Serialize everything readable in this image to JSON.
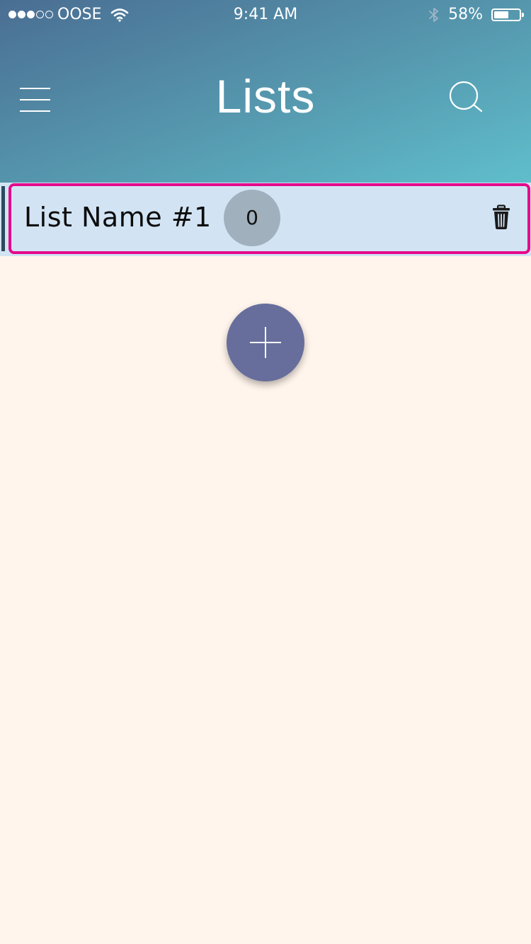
{
  "status_bar": {
    "carrier": "OOSE",
    "time": "9:41 AM",
    "battery_percent_label": "58%",
    "battery_level": 0.58,
    "signal_strength": 3,
    "signal_total": 5
  },
  "header": {
    "title": "Lists",
    "menu_icon": "hamburger-menu-icon",
    "search_icon": "search-icon"
  },
  "lists": [
    {
      "name": "List Name #1",
      "count": "0",
      "delete_icon": "trash-icon"
    }
  ],
  "add_button": {
    "icon": "plus-icon"
  },
  "colors": {
    "header_gradient_start": "#4a6e93",
    "header_gradient_end": "#5fbecb",
    "background": "#fff5ec",
    "list_item_bg": "#d2e4f4",
    "selected_border": "#e4098c",
    "badge_bg": "#a1b0bd",
    "fab_bg": "#676e9c"
  }
}
